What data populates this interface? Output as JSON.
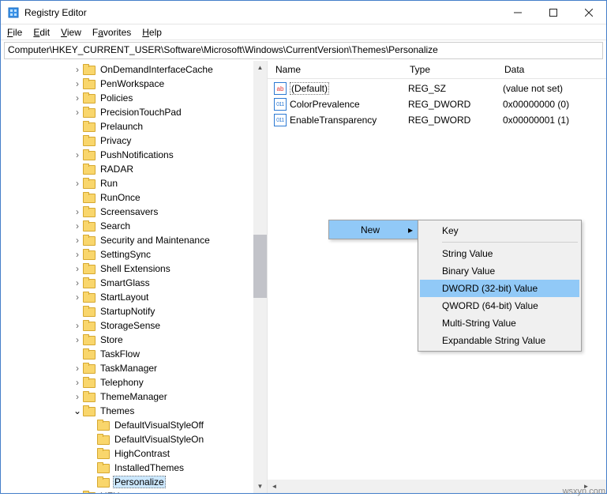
{
  "window": {
    "title": "Registry Editor"
  },
  "menu": {
    "file": "File",
    "edit": "Edit",
    "view": "View",
    "favorites": "Favorites",
    "help": "Help"
  },
  "address": "Computer\\HKEY_CURRENT_USER\\Software\\Microsoft\\Windows\\CurrentVersion\\Themes\\Personalize",
  "list": {
    "headers": {
      "name": "Name",
      "type": "Type",
      "data": "Data"
    },
    "rows": [
      {
        "icon": "str",
        "name": "(Default)",
        "type": "REG_SZ",
        "data": "(value not set)",
        "default": true
      },
      {
        "icon": "bin",
        "name": "ColorPrevalence",
        "type": "REG_DWORD",
        "data": "0x00000000 (0)"
      },
      {
        "icon": "bin",
        "name": "EnableTransparency",
        "type": "REG_DWORD",
        "data": "0x00000001 (1)"
      }
    ]
  },
  "tree": [
    {
      "ind": 5,
      "exp": ">",
      "label": "OnDemandInterfaceCache"
    },
    {
      "ind": 5,
      "exp": ">",
      "label": "PenWorkspace"
    },
    {
      "ind": 5,
      "exp": ">",
      "label": "Policies"
    },
    {
      "ind": 5,
      "exp": ">",
      "label": "PrecisionTouchPad"
    },
    {
      "ind": 5,
      "exp": "",
      "label": "Prelaunch"
    },
    {
      "ind": 5,
      "exp": "",
      "label": "Privacy"
    },
    {
      "ind": 5,
      "exp": ">",
      "label": "PushNotifications"
    },
    {
      "ind": 5,
      "exp": "",
      "label": "RADAR"
    },
    {
      "ind": 5,
      "exp": ">",
      "label": "Run"
    },
    {
      "ind": 5,
      "exp": "",
      "label": "RunOnce"
    },
    {
      "ind": 5,
      "exp": ">",
      "label": "Screensavers"
    },
    {
      "ind": 5,
      "exp": ">",
      "label": "Search"
    },
    {
      "ind": 5,
      "exp": ">",
      "label": "Security and Maintenance"
    },
    {
      "ind": 5,
      "exp": ">",
      "label": "SettingSync"
    },
    {
      "ind": 5,
      "exp": ">",
      "label": "Shell Extensions"
    },
    {
      "ind": 5,
      "exp": ">",
      "label": "SmartGlass"
    },
    {
      "ind": 5,
      "exp": ">",
      "label": "StartLayout"
    },
    {
      "ind": 5,
      "exp": "",
      "label": "StartupNotify"
    },
    {
      "ind": 5,
      "exp": ">",
      "label": "StorageSense"
    },
    {
      "ind": 5,
      "exp": ">",
      "label": "Store"
    },
    {
      "ind": 5,
      "exp": "",
      "label": "TaskFlow"
    },
    {
      "ind": 5,
      "exp": ">",
      "label": "TaskManager"
    },
    {
      "ind": 5,
      "exp": ">",
      "label": "Telephony"
    },
    {
      "ind": 5,
      "exp": ">",
      "label": "ThemeManager"
    },
    {
      "ind": 5,
      "exp": "v",
      "label": "Themes"
    },
    {
      "ind": 6,
      "exp": "",
      "label": "DefaultVisualStyleOff"
    },
    {
      "ind": 6,
      "exp": "",
      "label": "DefaultVisualStyleOn"
    },
    {
      "ind": 6,
      "exp": "",
      "label": "HighContrast"
    },
    {
      "ind": 6,
      "exp": "",
      "label": "InstalledThemes"
    },
    {
      "ind": 6,
      "exp": "",
      "label": "Personalize",
      "selected": true
    },
    {
      "ind": 5,
      "exp": ">",
      "label": "UFH"
    }
  ],
  "context": {
    "newLabel": "New",
    "items": [
      {
        "label": "Key"
      },
      {
        "sep": true
      },
      {
        "label": "String Value"
      },
      {
        "label": "Binary Value"
      },
      {
        "label": "DWORD (32-bit) Value",
        "highlight": true
      },
      {
        "label": "QWORD (64-bit) Value"
      },
      {
        "label": "Multi-String Value"
      },
      {
        "label": "Expandable String Value"
      }
    ]
  },
  "watermark": "wsxyn.com"
}
